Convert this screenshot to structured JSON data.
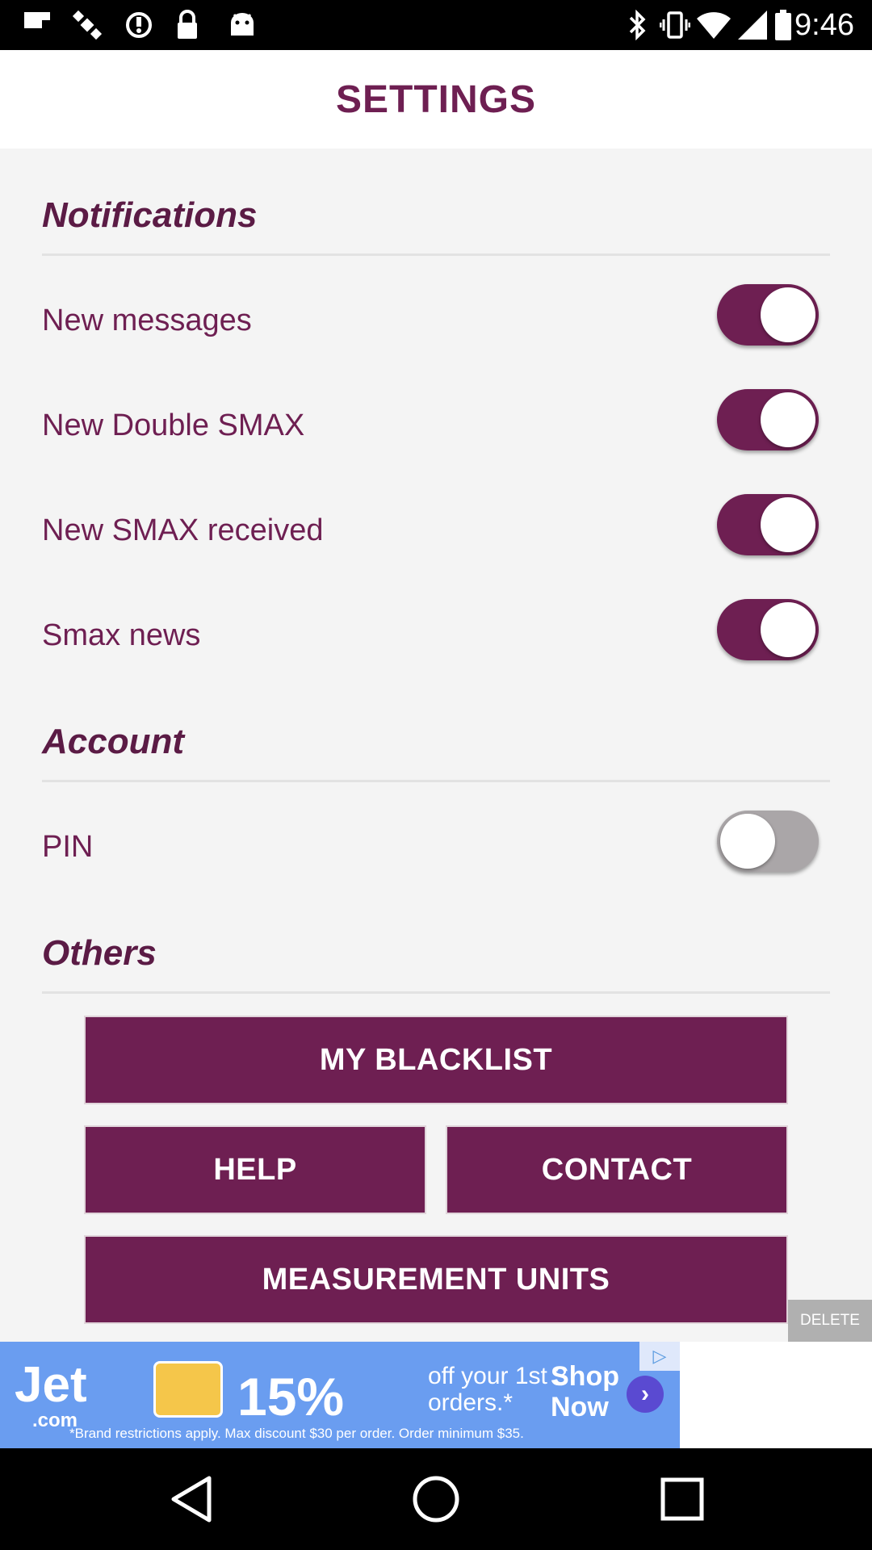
{
  "status_bar": {
    "time": "9:46",
    "left_icons": [
      "flipboard-icon",
      "satellite-icon",
      "sync-icon",
      "lock-icon",
      "android-icon"
    ],
    "right_icons": [
      "bluetooth-icon",
      "vibrate-icon",
      "wifi-icon",
      "signal-icon",
      "battery-icon"
    ]
  },
  "header": {
    "title": "SETTINGS"
  },
  "sections": {
    "notifications": {
      "title": "Notifications",
      "items": [
        {
          "label": "New messages",
          "on": true
        },
        {
          "label": "New Double SMAX",
          "on": true
        },
        {
          "label": "New SMAX received",
          "on": true
        },
        {
          "label": "Smax news",
          "on": true
        }
      ]
    },
    "account": {
      "title": "Account",
      "items": [
        {
          "label": "PIN",
          "on": false
        }
      ]
    },
    "others": {
      "title": "Others",
      "buttons": {
        "blacklist": "MY BLACKLIST",
        "help": "HELP",
        "contact": "CONTACT",
        "units": "MEASUREMENT UNITS"
      }
    }
  },
  "delete_label": "DELETE",
  "ad": {
    "logo": "Jet",
    "logo_sub": ".com",
    "percent": "15%",
    "offer": "off your 1st 3 orders.*",
    "shop": "Shop Now",
    "fine_print": "*Brand restrictions apply. Max discount $30 per order. Order minimum $35."
  },
  "colors": {
    "accent": "#6e1f52",
    "section_title": "#5b1b45",
    "background": "#f4f4f4",
    "toggle_off": "#aaa6a8"
  },
  "nav_bar": {
    "icons": [
      "back-icon",
      "home-icon",
      "recents-icon"
    ]
  }
}
